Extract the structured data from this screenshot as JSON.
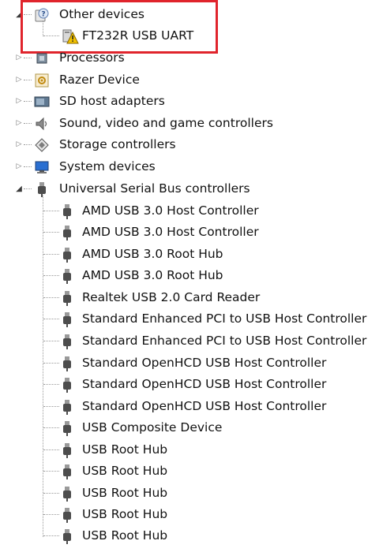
{
  "tree": {
    "other_devices": {
      "label": "Other devices",
      "icon": "other-devices-icon",
      "children": [
        {
          "label": "FT232R USB UART",
          "icon": "warning-device-icon"
        }
      ]
    },
    "categories": [
      {
        "label": "Processors",
        "icon": "processor-icon"
      },
      {
        "label": "Razer Device",
        "icon": "razer-device-icon"
      },
      {
        "label": "SD host adapters",
        "icon": "sd-adapter-icon"
      },
      {
        "label": "Sound, video and game controllers",
        "icon": "speaker-icon"
      },
      {
        "label": "Storage controllers",
        "icon": "storage-icon"
      },
      {
        "label": "System devices",
        "icon": "system-devices-icon"
      }
    ],
    "usb": {
      "label": "Universal Serial Bus controllers",
      "icon": "usb-plug-icon",
      "children": [
        "AMD USB 3.0 Host Controller",
        "AMD USB 3.0 Host Controller",
        "AMD USB 3.0 Root Hub",
        "AMD USB 3.0 Root Hub",
        "Realtek USB 2.0 Card Reader",
        "Standard Enhanced PCI to USB Host Controller",
        "Standard Enhanced PCI to USB Host Controller",
        "Standard OpenHCD USB Host Controller",
        "Standard OpenHCD USB Host Controller",
        "Standard OpenHCD USB Host Controller",
        "USB Composite Device",
        "USB Root Hub",
        "USB Root Hub",
        "USB Root Hub",
        "USB Root Hub",
        "USB Root Hub"
      ]
    }
  },
  "colors": {
    "highlight": "#e0242c",
    "warning": "#f2c200",
    "usb_icon": "#555555"
  }
}
